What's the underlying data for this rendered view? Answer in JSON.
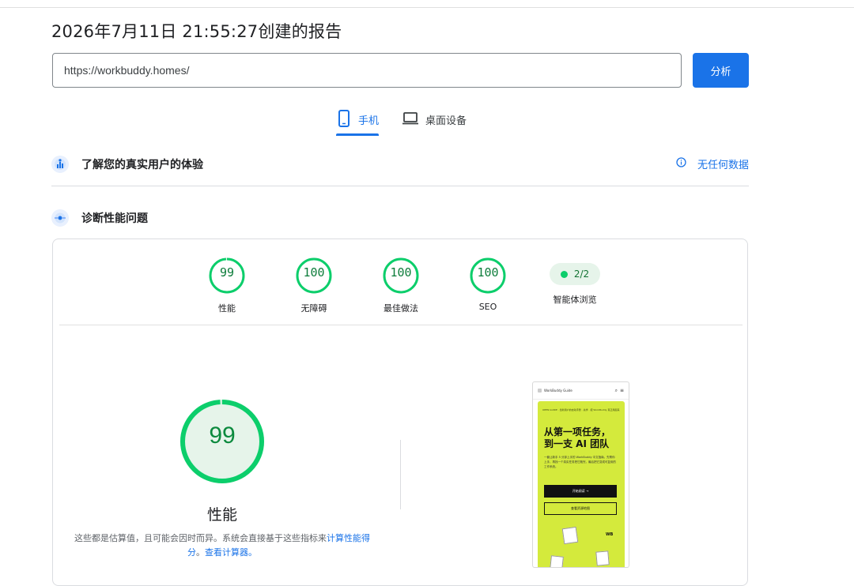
{
  "report": {
    "title": "2026年7月11日 21:55:27创建的报告"
  },
  "search": {
    "url_value": "https://workbuddy.homes/",
    "analyze_label": "分析"
  },
  "tabs": [
    {
      "label": "手机",
      "icon": "smartphone-icon",
      "active": true
    },
    {
      "label": "桌面设备",
      "icon": "laptop-icon",
      "active": false
    }
  ],
  "sections": {
    "field_data": {
      "title": "了解您的真实用户的体验",
      "icon": "users-chart-icon",
      "no_data_label": "无任何数据",
      "no_data_icon": "info-icon"
    },
    "lab_data": {
      "title": "诊断性能问题",
      "icon": "lab-pulse-icon"
    }
  },
  "scores": [
    {
      "value": "99",
      "label": "性能",
      "percent": 99
    },
    {
      "value": "100",
      "label": "无障碍",
      "percent": 100
    },
    {
      "value": "100",
      "label": "最佳做法",
      "percent": 100
    },
    {
      "value": "100",
      "label": "SEO",
      "percent": 100
    }
  ],
  "agentic": {
    "value": "2/2",
    "label": "智能体浏览"
  },
  "performance": {
    "score": "99",
    "percent": 99,
    "label": "性能",
    "note_text": "这些都是估算值，且可能会因时而异。系统会直接基于这些指标来",
    "note_link1": "计算性能得分",
    "note_mid": "。",
    "note_link2": "查看计算器。"
  },
  "colors": {
    "accent": "#1a73e8",
    "pass_green": "#0cce6b",
    "pass_text": "#0c7c3a",
    "pass_bg": "#e6f4ea"
  },
  "thumbnail": {
    "site_name": "WorkBuddy Guide",
    "tagline": "OPEN GUIDE · 给新用户的启动手册 · 先学 · 把 WorkBuddy 真正用起来 · 正在更新",
    "headline": "从第一项任务，\n到一支 AI 团队",
    "subtext": "一套让新手 5 分钟上手的 WorkBuddy 中文指南。先帮你上手，再找一个真实任务把它跑完，最后把它变成可复用的工作系统。",
    "primary_cta": "开始阅读 →",
    "secondary_cta": "查看资源地图",
    "badge": "WB"
  }
}
